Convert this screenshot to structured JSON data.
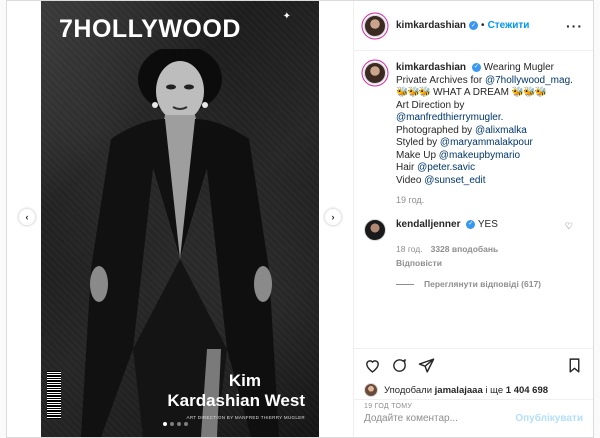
{
  "cover": {
    "masthead": "7HOLLYWOOD",
    "name_first": "Kim",
    "name_last": "Kardashian West",
    "credit": "ART DIRECTION BY MANFRED THIERRY MUGLER"
  },
  "carousel": {
    "slides": 4,
    "active": 1
  },
  "header": {
    "username": "kimkardashian",
    "separator": "•",
    "follow_label": "Стежити",
    "more_label": "···"
  },
  "caption": {
    "username": "kimkardashian",
    "text_1": "Wearing Mugler Private Archives for",
    "link_1": "@7hollywood_mag",
    "text_2": ".",
    "bees_1": "🐝🐝🐝",
    "text_3": "WHAT A DREAM",
    "bees_2": "🐝🐝🐝",
    "line_1": "Art Direction by",
    "link_2": "@manfredthierrymugler",
    "line_1_end": ".",
    "line_2": "Photographed by",
    "link_3": "@alixmalka",
    "line_3": "Styled by",
    "link_4": "@maryammalakpour",
    "line_4": "Make Up",
    "link_5": "@makeupbymario",
    "line_5": "Hair",
    "link_6": "@peter.savic",
    "line_6": "Video",
    "link_7": "@sunset_edit",
    "time": "19 год."
  },
  "comment": {
    "username": "kendalljenner",
    "text": "YES",
    "time": "18 год.",
    "likes": "3328 вподобань",
    "reply": "Відповісти",
    "view_replies": "Переглянути відповіді (617)"
  },
  "likes": {
    "prefix": "Уподобали",
    "user": "jamalajaaa",
    "middle": "і ще",
    "count": "1 404 698"
  },
  "post_time": "19 ГОД ТОМУ",
  "add_comment": {
    "placeholder": "Додайте коментар...",
    "publish_label": "Опублікувати"
  },
  "colors": {
    "accent_blue": "#0095f6",
    "link": "#00376b",
    "muted": "#8e8e8e",
    "verified": "#3897f0"
  }
}
